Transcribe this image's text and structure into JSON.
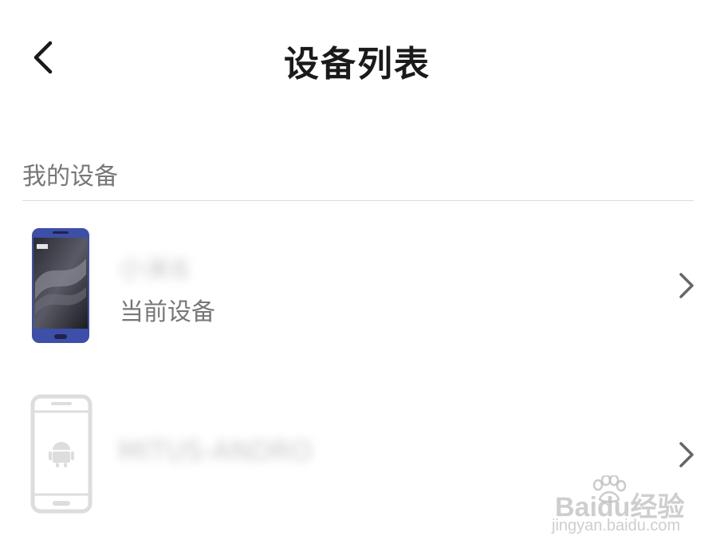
{
  "header": {
    "back_icon": "chevron-left-icon",
    "title": "设备列表"
  },
  "section": {
    "label": "我的设备"
  },
  "devices": [
    {
      "name": "小米6",
      "subtitle": "当前设备",
      "image": "smartphone-blue-icon",
      "chevron_icon": "chevron-right-icon"
    },
    {
      "name": "MITUS-ANDRO",
      "subtitle": "",
      "image": "android-phone-placeholder-icon",
      "chevron_icon": "chevron-right-icon"
    }
  ],
  "watermark": {
    "brand": "Baidu经验",
    "url": "jingyan.baidu.com"
  },
  "colors": {
    "title_text": "#1a1a1a",
    "secondary_text": "#777777",
    "divider": "#dcdcdc",
    "chevron": "#666666",
    "phone_blue": "#3d4fa8",
    "placeholder_gray": "#dddddd"
  }
}
